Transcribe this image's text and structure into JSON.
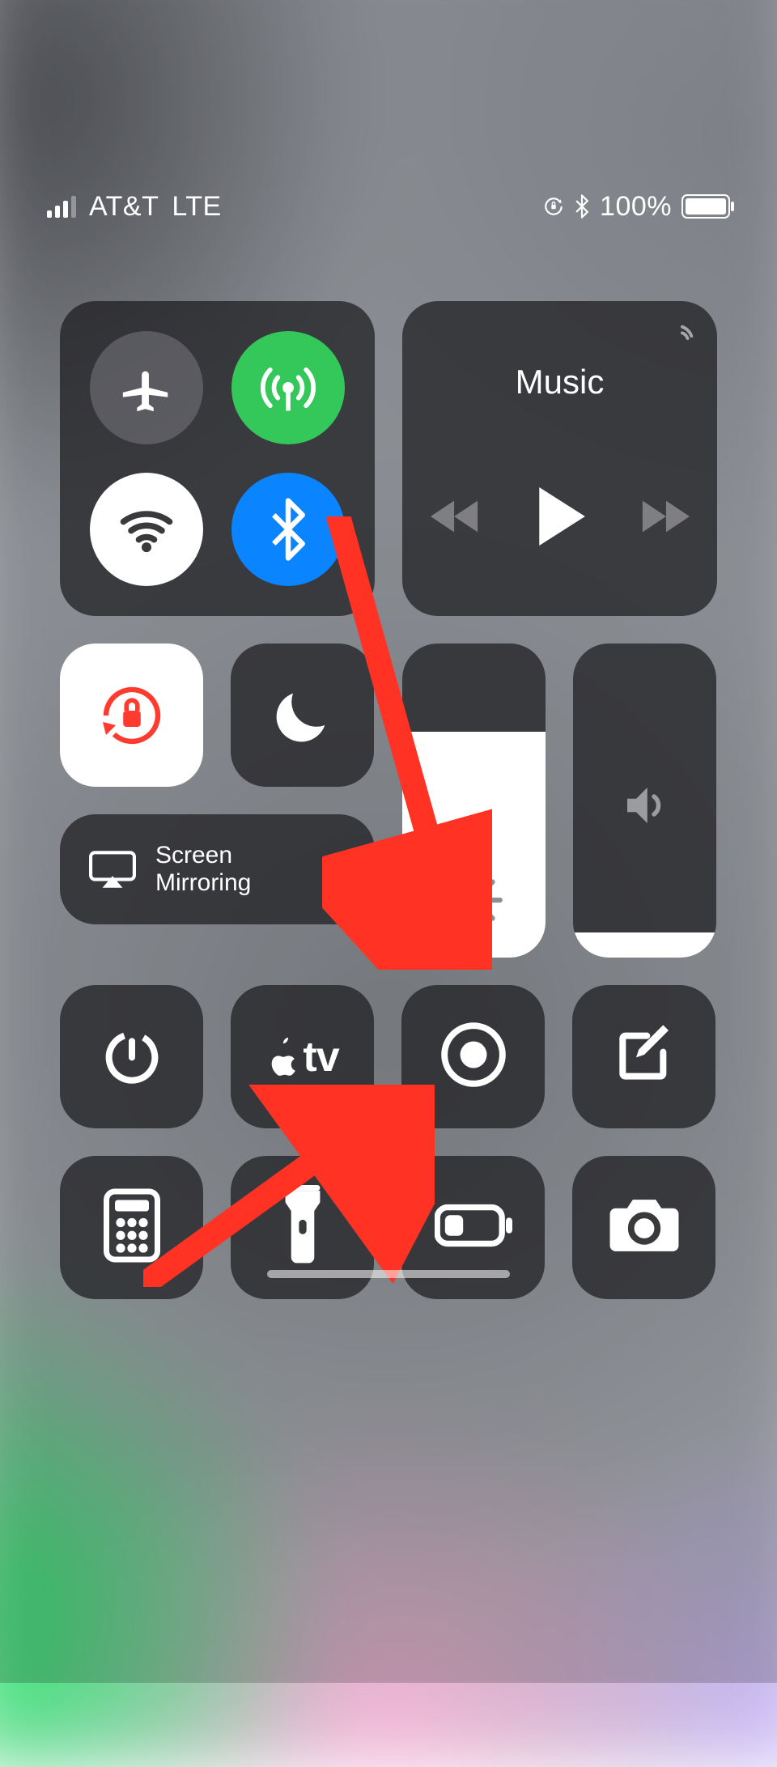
{
  "statusbar": {
    "carrier": "AT&T",
    "network": "LTE",
    "battery_pct": "100%",
    "signal_bars_active": 3,
    "signal_bars_total": 4,
    "orientation_lock": true,
    "bluetooth_status": true
  },
  "connectivity": {
    "airplane": {
      "on": false,
      "color": "#8e8e93"
    },
    "cellular": {
      "on": true,
      "color": "#34c759"
    },
    "wifi": {
      "on": true,
      "color": "#ffffff"
    },
    "bluetooth": {
      "on": true,
      "color": "#0a84ff"
    }
  },
  "music": {
    "title": "Music",
    "playing": false
  },
  "toggles": {
    "orientation_lock": {
      "on": true
    },
    "do_not_disturb": {
      "on": false
    },
    "screen_mirroring_label": "Screen\nMirroring"
  },
  "sliders": {
    "brightness": {
      "value_pct": 72
    },
    "volume": {
      "value_pct": 8
    }
  },
  "actions_row1": {
    "timer": "timer",
    "appletv": "tv",
    "screen_record": "record",
    "notes": "note"
  },
  "actions_row2": {
    "calculator": "calculator",
    "flashlight": "flashlight",
    "low_power": "battery",
    "camera": "camera"
  },
  "annotation": {
    "target": "screen-record-button",
    "color": "#ff3224"
  }
}
